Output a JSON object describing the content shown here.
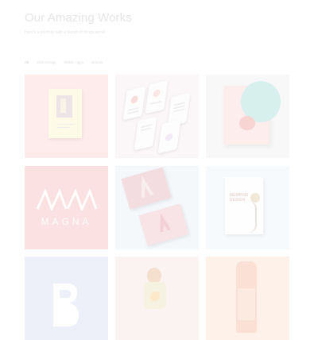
{
  "header": {
    "title": "Our Amazing Works",
    "subtitle": "Here's a portfolio with a bunch of things we've"
  },
  "filters": [
    {
      "label": "All",
      "active": true
    },
    {
      "label": "Web Design",
      "active": false
    },
    {
      "label": "Mobile Apps",
      "active": false
    },
    {
      "label": "Brands",
      "active": false
    }
  ],
  "portfolio": {
    "tiles": [
      {
        "background": "#fdeceb",
        "content": "book-cover"
      },
      {
        "background": "#fbf6f7",
        "content": "mobile-app-screens"
      },
      {
        "background": "#f8f8f8",
        "content": "card-with-circle"
      },
      {
        "background": "#fbe1e1",
        "content": "magna-logo",
        "logo_text": "MAGNA"
      },
      {
        "background": "#f5f8fb",
        "content": "business-cards"
      },
      {
        "background": "#f7fafc",
        "content": "poster",
        "poster_text": "MEMPHIS DESIGN"
      },
      {
        "background": "#edf0f8",
        "content": "letter-b-logo"
      },
      {
        "background": "#fbf3f2",
        "content": "character-illustration"
      },
      {
        "background": "#fdf1ea",
        "content": "bottle-packaging"
      }
    ]
  },
  "colors": {
    "title_text": "#e6e6e6",
    "filter_text": "#e0e0e0",
    "accent_pink": "#fbe1e1"
  }
}
